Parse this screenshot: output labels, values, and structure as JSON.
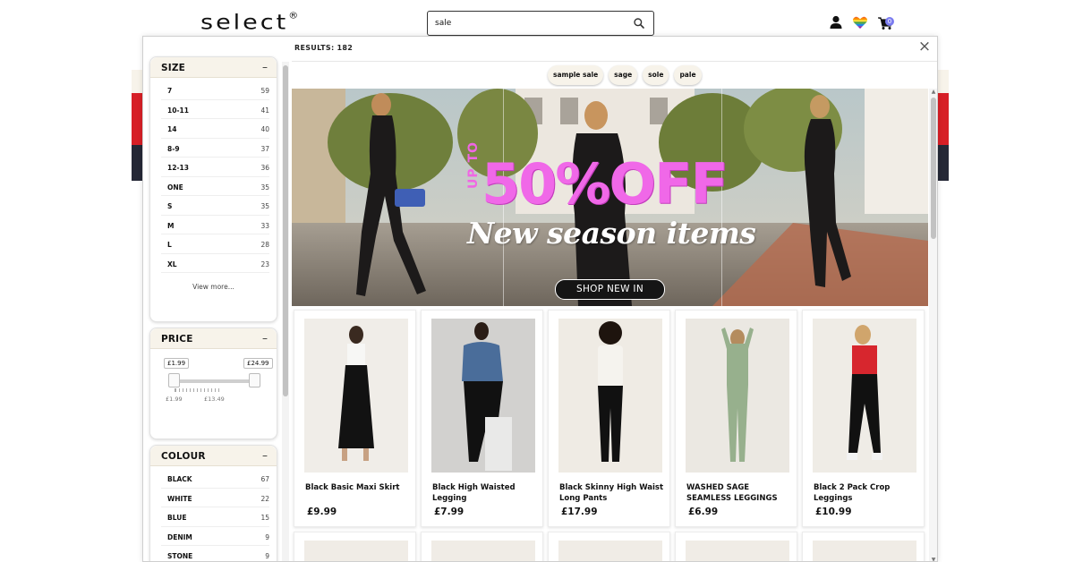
{
  "header": {
    "logo": "select",
    "logo_mark": "®",
    "search_value": "sale",
    "cart_count": "0"
  },
  "results_label": "RESULTS: 182",
  "close_label": "×",
  "suggestions": [
    "sample sale",
    "sage",
    "sole",
    "pale"
  ],
  "filters": {
    "size": {
      "title": "SIZE",
      "toggle": "–",
      "options": [
        {
          "label": "7",
          "count": "59"
        },
        {
          "label": "10-11",
          "count": "41"
        },
        {
          "label": "14",
          "count": "40"
        },
        {
          "label": "8-9",
          "count": "37"
        },
        {
          "label": "12-13",
          "count": "36"
        },
        {
          "label": "ONE",
          "count": "35"
        },
        {
          "label": "S",
          "count": "35"
        },
        {
          "label": "M",
          "count": "33"
        },
        {
          "label": "L",
          "count": "28"
        },
        {
          "label": "XL",
          "count": "23"
        }
      ],
      "view_more": "View more..."
    },
    "price": {
      "title": "PRICE",
      "toggle": "–",
      "min_value": "£1.99",
      "max_value": "£24.99",
      "tick_min": "£1.99",
      "tick_mid": "£13.49"
    },
    "colour": {
      "title": "COLOUR",
      "toggle": "–",
      "options": [
        {
          "label": "BLACK",
          "count": "67"
        },
        {
          "label": "WHITE",
          "count": "22"
        },
        {
          "label": "BLUE",
          "count": "15"
        },
        {
          "label": "DENIM",
          "count": "9"
        },
        {
          "label": "STONE",
          "count": "9"
        }
      ]
    }
  },
  "banner": {
    "up_to": "UP TO",
    "discount": "50%OFF",
    "tagline": "New season items",
    "cta": "SHOP NEW IN"
  },
  "products": [
    {
      "name": "Black Basic Maxi Skirt",
      "price": "£9.99"
    },
    {
      "name": "Black High Waisted Legging",
      "price": "£7.99"
    },
    {
      "name": "Black Skinny High Waist Long Pants",
      "price": "£17.99"
    },
    {
      "name": "WASHED SAGE SEAMLESS LEGGINGS",
      "price": "£6.99"
    },
    {
      "name": "Black 2 Pack Crop Leggings",
      "price": "£10.99"
    }
  ],
  "colors": {
    "accent_cream": "#f7f3ea",
    "brand_red": "#d71f26",
    "banner_pink": "#f068e8",
    "badge_purple": "#7b7cf0"
  },
  "icons": {
    "search": "search-icon",
    "account": "user-icon",
    "pride": "heart-icon",
    "cart": "cart-icon",
    "close": "close-icon"
  }
}
